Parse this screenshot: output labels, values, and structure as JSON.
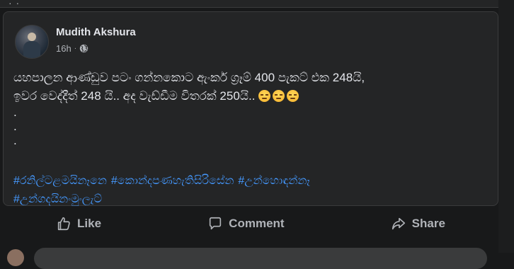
{
  "post": {
    "author": "Mudith Akshura",
    "time": "16h",
    "meta_separator": "·",
    "privacy_icon": "globe-icon",
    "text_line_1": "යහපාලන ආණ්ඩුව පටං ගන්නකොට ඇංකර් ග්‍රෑම් 400 පැකට් එක 248යි,",
    "text_line_2": "ඉවර වෙද්දීත් 248 යි.. අද වැඩ්ඩීම විතරක් 250යි..",
    "emoji_count": 3,
    "dot": ".",
    "hashtags": [
      "#රනිල්ටළමයිනෑනෙ",
      "#කොන්දපණහැතිසිරිසේන",
      "#උන්හොඳන්නෑ",
      "#උන්ගදයිනංමුංලැට්"
    ]
  },
  "actions": {
    "like_label": "Like",
    "comment_label": "Comment",
    "share_label": "Share"
  },
  "colors": {
    "background": "#18191a",
    "card": "#242526",
    "text_primary": "#e4e6eb",
    "text_secondary": "#b0b3b8",
    "link": "#4599ff"
  }
}
